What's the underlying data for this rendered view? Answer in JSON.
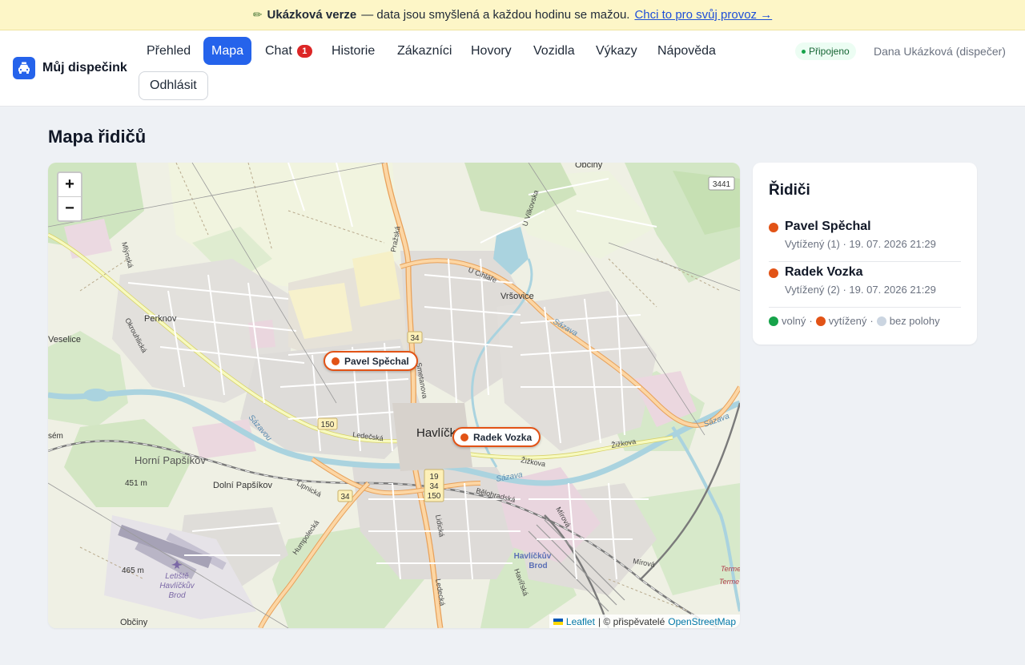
{
  "banner": {
    "title": "Ukázková verze",
    "text": "— data jsou smyšlená a každou hodinu se mažou.",
    "link": "Chci to pro svůj provoz →"
  },
  "brand": {
    "name": "Můj dispečink"
  },
  "nav": {
    "items": [
      {
        "label": "Přehled"
      },
      {
        "label": "Mapa",
        "active": true
      },
      {
        "label": "Chat",
        "badge": "1"
      },
      {
        "label": "Historie"
      },
      {
        "label": "Zákazníci"
      },
      {
        "label": "Hovory"
      },
      {
        "label": "Vozidla"
      },
      {
        "label": "Výkazy"
      },
      {
        "label": "Nápověda"
      }
    ],
    "logout": "Odhlásit"
  },
  "status": {
    "label": "Připojeno",
    "color": "#16a34a"
  },
  "user": {
    "name": "Dana Ukázková (dispečer)"
  },
  "page": {
    "title": "Mapa řidičů"
  },
  "map": {
    "zoom_in": "+",
    "zoom_out": "−",
    "attribution": {
      "leaflet": "Leaflet",
      "separator": "| © přispěvatelé",
      "osm": "OpenStreetMap"
    },
    "labels": {
      "town": "Havlíčk",
      "obciny_top": "Obciny",
      "obciny_bottom": "Občiny",
      "perknov": "Perknov",
      "veselice": "Veselice",
      "vrsovice": "Vršovice",
      "horni_papsikov": "Horní Papšíkov",
      "dolni_papsikov": "Dolní Papšíkov",
      "elev_451": "451 m",
      "elev_465": "465 m",
      "sem": "sém",
      "letiste": "Letiště",
      "letiste2": "Havlíčkův",
      "letiste3": "Brod",
      "station": "Havlíčkův",
      "station2": "Brod",
      "road_34": "34",
      "road_150": "150",
      "road_3441": "3441",
      "road_19": "19",
      "road_34b": "34",
      "road_150b": "150",
      "road_34c": "34",
      "street_prazska": "Pražská",
      "street_okrouhlicka": "Okrouhlická",
      "street_mlynska": "Mlýnská",
      "street_ledecska": "Ledečská",
      "street_zizkova": "Žižkova",
      "street_zizkova2": "Žižkova",
      "street_lipnicka": "Lipnická",
      "street_humpolecka": "Humpolecká",
      "street_belohradska": "Bělohradská",
      "street_mirova": "Mírová",
      "street_mirova2": "Mírová",
      "street_havirska": "Havířská",
      "street_ledecka": "Ledecká",
      "street_sazavou": "Sázavou",
      "street_vilkovska": "U Vilkovska",
      "street_cihlare": "U Cihláře",
      "street_sazava": "Sázava",
      "street_sazava2": "Sázava",
      "street_sazava3": "Sázava",
      "street_terme": "Terme",
      "street_terme2": "Terme",
      "street_smetanova": "Smetanova",
      "street_lidicka": "Lidická"
    },
    "markers": [
      {
        "name": "Pavel Spěchal",
        "color": "#e25316"
      },
      {
        "name": "Radek Vozka",
        "color": "#e25316"
      }
    ]
  },
  "panel": {
    "title": "Řidiči",
    "drivers": [
      {
        "name": "Pavel Spěchal",
        "info": "Vytížený (1) · 19. 07. 2026 21:29",
        "color": "#e25316"
      },
      {
        "name": "Radek Vozka",
        "info": "Vytížený (2) · 19. 07. 2026 21:29",
        "color": "#e25316"
      }
    ],
    "legend": [
      {
        "label": "volný",
        "color": "#16a34a",
        "sep": "·"
      },
      {
        "label": "vytížený",
        "color": "#e25316",
        "sep": "·"
      },
      {
        "label": "bez polohy",
        "color": "#cbd5e1",
        "sep": ""
      }
    ]
  }
}
